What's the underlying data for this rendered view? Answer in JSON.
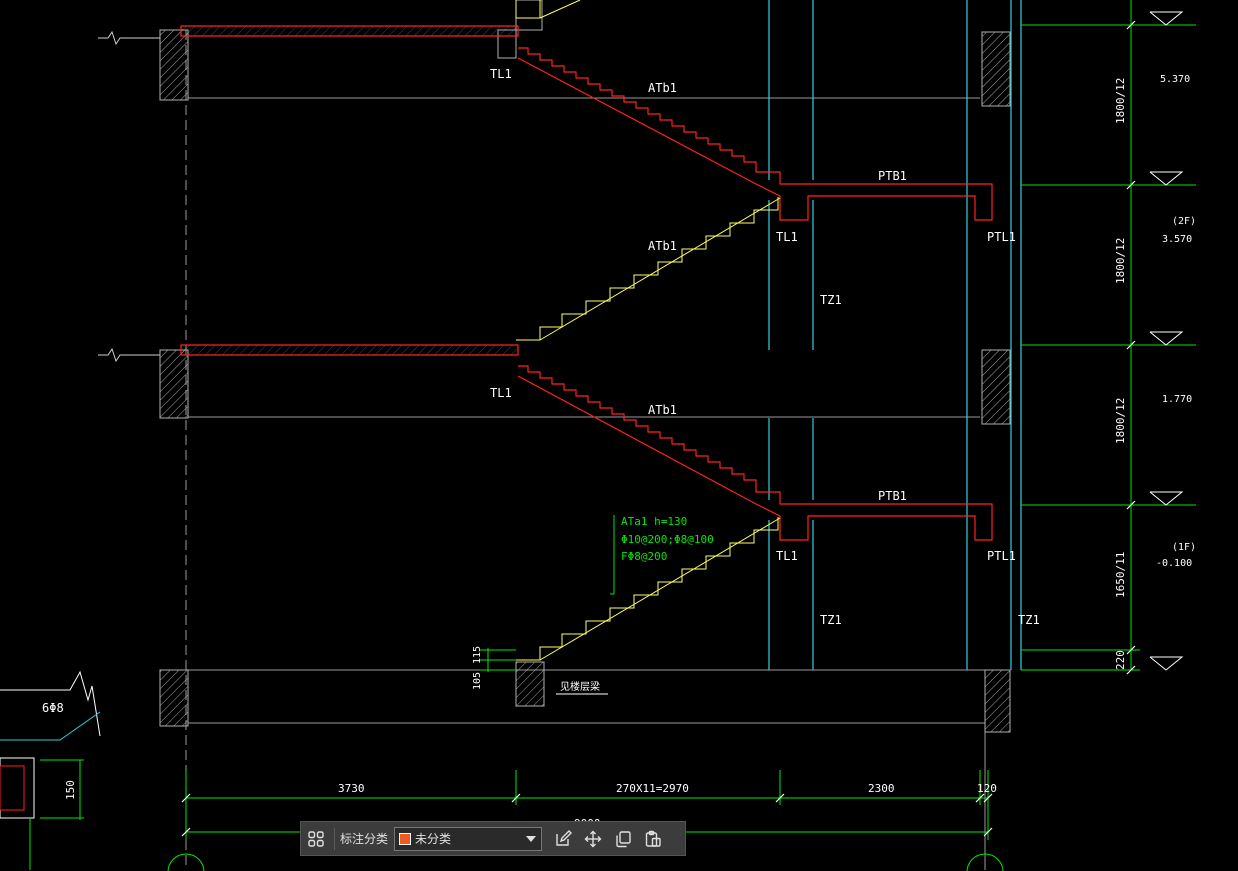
{
  "labels": {
    "tl1_a": "TL1",
    "tl1_b": "TL1",
    "tl1_c": "TL1",
    "tl1_d": "TL1",
    "atb1_a": "ATb1",
    "atb1_b": "ATb1",
    "atb1_c": "ATb1",
    "ptb1_a": "PTB1",
    "ptb1_b": "PTB1",
    "ptl1_a": "PTL1",
    "ptl1_b": "PTL1",
    "tz1_a": "TZ1",
    "tz1_b": "TZ1",
    "tz1_c": "TZ1",
    "note_line1": "ATa1 h=130",
    "note_line2": "Φ10@200;Φ8@100",
    "note_line3": "FΦ8@200",
    "see_beam": "见楼层梁",
    "rebar_6phi8": "6Φ8"
  },
  "elevations": {
    "e1": "5.370",
    "e2_floor": "(2F)",
    "e2": "3.570",
    "e3": "1.770",
    "e4_floor": "(1F)",
    "e4": "-0.100"
  },
  "vertical_dims": {
    "d1": "1800/12",
    "d2": "1800/12",
    "d3": "1800/12",
    "d4": "1650/11",
    "d5": "220",
    "d6": "115",
    "d7": "105",
    "d8": "150"
  },
  "horizontal_dims": {
    "h1": "3730",
    "h2": "270X11=2970",
    "h3": "2300",
    "h4": "120",
    "total": "9000"
  },
  "toolbar": {
    "category_label": "标注分类",
    "selected_category": "未分类",
    "swatch_color": "#f05a22"
  },
  "colors": {
    "background": "#000000",
    "concrete_section": "#ff2020",
    "stair_elevation": "#ffff66",
    "axis_cyan": "#30d0e0",
    "dimension_green": "#00e800",
    "outline_white": "#ffffff"
  }
}
